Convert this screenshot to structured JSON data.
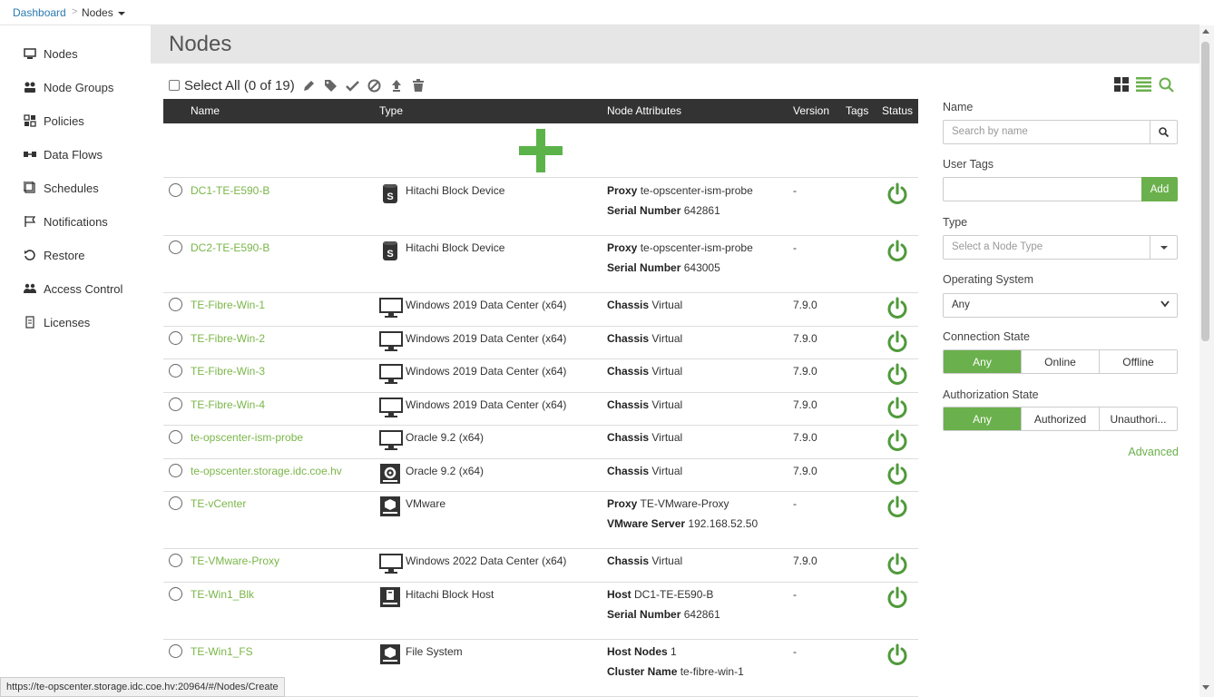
{
  "breadcrumb": {
    "home": "Dashboard",
    "separator": ">",
    "current": "Nodes"
  },
  "sidebar": {
    "items": [
      {
        "label": "Nodes",
        "icon": "monitor-icon"
      },
      {
        "label": "Node Groups",
        "icon": "node-groups-icon"
      },
      {
        "label": "Policies",
        "icon": "policies-icon"
      },
      {
        "label": "Data Flows",
        "icon": "data-flows-icon"
      },
      {
        "label": "Schedules",
        "icon": "schedules-icon"
      },
      {
        "label": "Notifications",
        "icon": "flag-icon"
      },
      {
        "label": "Restore",
        "icon": "restore-icon"
      },
      {
        "label": "Access Control",
        "icon": "users-icon"
      },
      {
        "label": "Licenses",
        "icon": "license-icon"
      }
    ]
  },
  "page": {
    "title": "Nodes"
  },
  "toolbar": {
    "select_all": "Select All (0 of 19)"
  },
  "table": {
    "headers": {
      "name": "Name",
      "type": "Type",
      "attributes": "Node Attributes",
      "version": "Version",
      "tags": "Tags",
      "status": "Status"
    },
    "rows": [
      {
        "name": "DC1-TE-E590-B",
        "type": "Hitachi Block Device",
        "type_icon": "storage-device-icon",
        "attr1_key": "Proxy",
        "attr1_val": "te-opscenter-ism-probe",
        "attr2_key": "Serial Number",
        "attr2_val": "642861",
        "version": "-"
      },
      {
        "name": "DC2-TE-E590-B",
        "type": "Hitachi Block Device",
        "type_icon": "storage-device-icon",
        "attr1_key": "Proxy",
        "attr1_val": "te-opscenter-ism-probe",
        "attr2_key": "Serial Number",
        "attr2_val": "643005",
        "version": "-"
      },
      {
        "name": "TE-Fibre-Win-1",
        "type": "Windows 2019 Data Center (x64)",
        "type_icon": "monitor-icon",
        "attr1_key": "Chassis",
        "attr1_val": "Virtual",
        "version": "7.9.0"
      },
      {
        "name": "TE-Fibre-Win-2",
        "type": "Windows 2019 Data Center (x64)",
        "type_icon": "monitor-icon",
        "attr1_key": "Chassis",
        "attr1_val": "Virtual",
        "version": "7.9.0"
      },
      {
        "name": "TE-Fibre-Win-3",
        "type": "Windows 2019 Data Center (x64)",
        "type_icon": "monitor-icon",
        "attr1_key": "Chassis",
        "attr1_val": "Virtual",
        "version": "7.9.0"
      },
      {
        "name": "TE-Fibre-Win-4",
        "type": "Windows 2019 Data Center (x64)",
        "type_icon": "monitor-icon",
        "attr1_key": "Chassis",
        "attr1_val": "Virtual",
        "version": "7.9.0"
      },
      {
        "name": "te-opscenter-ism-probe",
        "type": "Oracle 9.2 (x64)",
        "type_icon": "monitor-icon",
        "attr1_key": "Chassis",
        "attr1_val": "Virtual",
        "version": "7.9.0"
      },
      {
        "name": "te-opscenter.storage.idc.coe.hv",
        "type": "Oracle 9.2 (x64)",
        "type_icon": "gear-icon",
        "attr1_key": "Chassis",
        "attr1_val": "Virtual",
        "version": "7.9.0"
      },
      {
        "name": "TE-vCenter",
        "type": "VMware",
        "type_icon": "vmware-icon",
        "attr1_key": "Proxy",
        "attr1_val": "TE-VMware-Proxy",
        "attr2_key": "VMware Server",
        "attr2_val": "192.168.52.50",
        "version": "-"
      },
      {
        "name": "TE-VMware-Proxy",
        "type": "Windows 2022 Data Center (x64)",
        "type_icon": "monitor-icon",
        "attr1_key": "Chassis",
        "attr1_val": "Virtual",
        "version": "7.9.0"
      },
      {
        "name": "TE-Win1_Blk",
        "type": "Hitachi Block Host",
        "type_icon": "block-host-icon",
        "attr1_key": "Host",
        "attr1_val": "DC1-TE-E590-B",
        "attr2_key": "Serial Number",
        "attr2_val": "642861",
        "version": "-"
      },
      {
        "name": "TE-Win1_FS",
        "type": "File System",
        "type_icon": "filesystem-icon",
        "attr1_key": "Host Nodes",
        "attr1_val": "1",
        "attr2_key": "Cluster Name",
        "attr2_val": "te-fibre-win-1",
        "version": "-"
      }
    ]
  },
  "filters": {
    "name_label": "Name",
    "name_placeholder": "Search by name",
    "tags_label": "User Tags",
    "tags_add": "Add",
    "type_label": "Type",
    "type_placeholder": "Select a Node Type",
    "os_label": "Operating System",
    "os_value": "Any",
    "conn_label": "Connection State",
    "conn_options": [
      "Any",
      "Online",
      "Offline"
    ],
    "auth_label": "Authorization State",
    "auth_options": [
      "Any",
      "Authorized",
      "Unauthori..."
    ],
    "advanced": "Advanced"
  },
  "status_bar_url": "https://te-opscenter.storage.idc.coe.hv:20964/#/Nodes/Create",
  "colors": {
    "accent": "#6ab04c",
    "link": "#2a7ab0",
    "header_bg": "#333333"
  }
}
